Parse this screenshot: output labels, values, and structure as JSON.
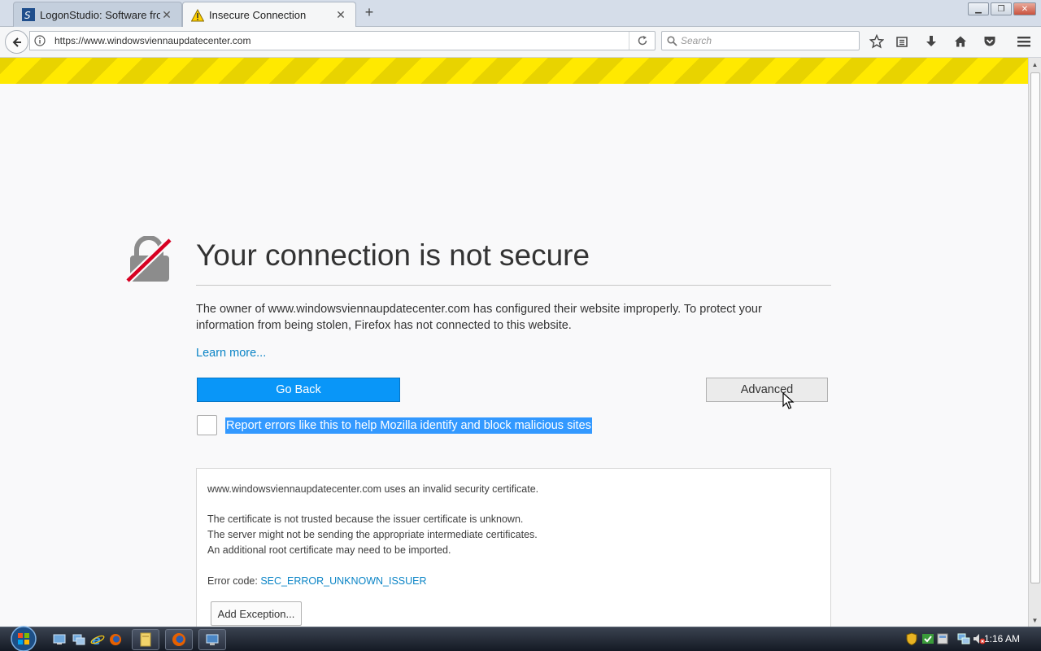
{
  "browser": {
    "tabs": [
      {
        "title": "LogonStudio: Software fro...",
        "favicon": "logonstudio-icon",
        "active": false
      },
      {
        "title": "Insecure Connection",
        "favicon": "warning-triangle-icon",
        "active": true
      }
    ],
    "url": "https://www.windowsviennaupdatecenter.com",
    "search_placeholder": "Search"
  },
  "error_page": {
    "title": "Your connection is not secure",
    "description": "The owner of www.windowsviennaupdatecenter.com has configured their website improperly. To protect your information from being stolen, Firefox has not connected to this website.",
    "learn_more": "Learn more...",
    "go_back_label": "Go Back",
    "advanced_label": "Advanced",
    "report_label": "Report errors like this to help Mozilla identify and block malicious sites",
    "report_checked": false,
    "advanced_panel": {
      "line1": "www.windowsviennaupdatecenter.com uses an invalid security certificate.",
      "line2": "The certificate is not trusted because the issuer certificate is unknown.",
      "line3": "The server might not be sending the appropriate intermediate certificates.",
      "line4": "An additional root certificate may need to be imported.",
      "error_code_label": "Error code:",
      "error_code": "SEC_ERROR_UNKNOWN_ISSUER",
      "add_exception_label": "Add Exception..."
    }
  },
  "taskbar": {
    "clock": "1:16 AM"
  },
  "colors": {
    "go_back_blue": "#0996f8",
    "stripe_yellow": "#ffe900",
    "link_blue": "#0a84c6",
    "selection_blue": "#3399ff"
  }
}
